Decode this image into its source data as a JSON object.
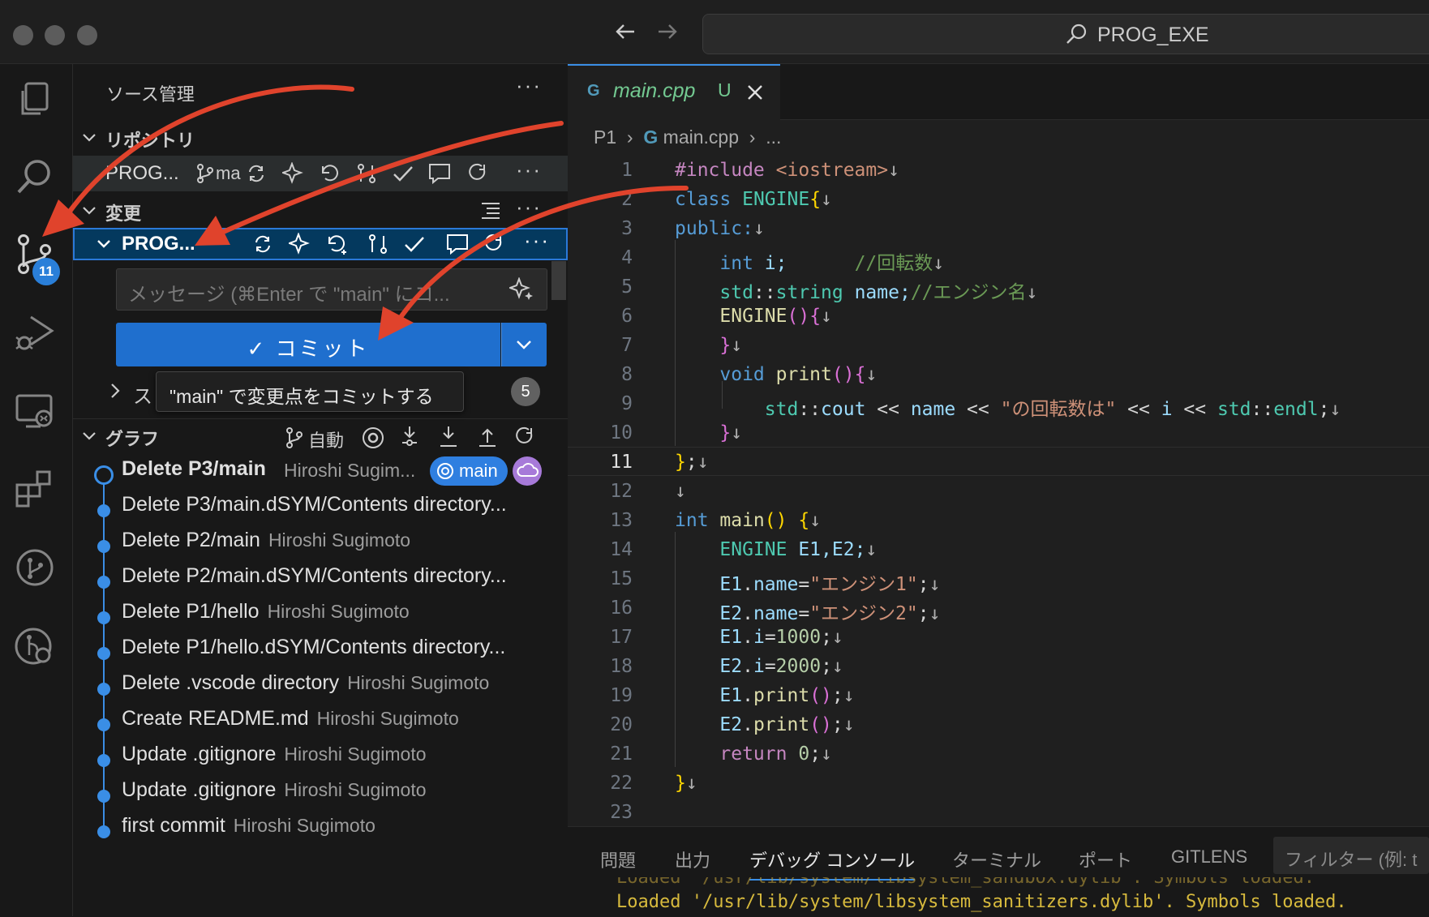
{
  "window": {
    "search_text": "PROG_EXE"
  },
  "activity_bar": {
    "items": [
      "explorer-icon",
      "search-icon",
      "source-control-icon",
      "run-debug-icon",
      "remote-explorer-icon",
      "extensions-icon",
      "git-graph-icon",
      "gitlens-icon"
    ],
    "source_control_badge": "11"
  },
  "sidebar": {
    "title": "ソース管理",
    "repos_section": "リポジトリ",
    "repo_name": "PROG...",
    "repo_branch": "ma",
    "changes_section": "変更",
    "changes_repo": "PROG...",
    "message_placeholder": "メッセージ (⌘Enter で \"main\" にコ...",
    "commit_label": "✓ コミット",
    "staged_label": "ス",
    "staged_count": "5",
    "tooltip": "\"main\" で変更点をコミットする",
    "graph_section": "グラフ",
    "graph_auto": "自動",
    "graph": [
      {
        "title": "Delete P3/main",
        "author": "Hiroshi Sugim..."
      },
      {
        "title": "Delete P3/main.dSYM/Contents directory...",
        "author": ""
      },
      {
        "title": "Delete P2/main",
        "author": "Hiroshi Sugimoto"
      },
      {
        "title": "Delete P2/main.dSYM/Contents directory...",
        "author": ""
      },
      {
        "title": "Delete P1/hello",
        "author": "Hiroshi Sugimoto"
      },
      {
        "title": "Delete P1/hello.dSYM/Contents directory...",
        "author": ""
      },
      {
        "title": "Delete .vscode directory",
        "author": "Hiroshi Sugimoto"
      },
      {
        "title": "Create README.md",
        "author": "Hiroshi Sugimoto"
      },
      {
        "title": "Update .gitignore",
        "author": "Hiroshi Sugimoto"
      },
      {
        "title": "Update .gitignore",
        "author": "Hiroshi Sugimoto"
      },
      {
        "title": "first commit",
        "author": "Hiroshi Sugimoto"
      }
    ],
    "head_branch": "main"
  },
  "editor": {
    "tab_name": "main.cpp",
    "tab_status": "U",
    "breadcrumb": [
      "P1",
      "main.cpp",
      "..."
    ],
    "active_line": 11,
    "line_numbers": [
      "1",
      "2",
      "3",
      "4",
      "5",
      "6",
      "7",
      "8",
      "9",
      "10",
      "11",
      "12",
      "13",
      "14",
      "15",
      "16",
      "17",
      "18",
      "19",
      "20",
      "21",
      "22",
      "23"
    ],
    "code_tokens": {
      "l1": [
        "#include",
        " <iostream>",
        "↓"
      ],
      "l2": [
        "class",
        " ENGINE",
        "{",
        "↓"
      ],
      "l3": [
        "public:",
        "↓"
      ],
      "l4": [
        "    int",
        " i;",
        "      //回転数",
        "↓"
      ],
      "l5": [
        "    std",
        "::",
        "string",
        " name;",
        "//エンジン名",
        "↓"
      ],
      "l6": [
        "    ENGINE",
        "()",
        "{",
        "↓"
      ],
      "l7": [
        "    }",
        "↓"
      ],
      "l8": [
        "    void",
        " print",
        "()",
        "{",
        "↓"
      ],
      "l9": [
        "        std",
        "::",
        "cout",
        " << ",
        "name",
        " << ",
        "\"の回転数は\"",
        " << ",
        "i",
        " << ",
        "std",
        "::",
        "endl",
        ";",
        "↓"
      ],
      "l10": [
        "    }",
        "↓"
      ],
      "l11": [
        "}",
        ";",
        "↓"
      ],
      "l12": [
        "↓"
      ],
      "l13": [
        "int",
        " main",
        "()",
        " {",
        "↓"
      ],
      "l14": [
        "    ENGINE",
        " E1,E2;",
        "↓"
      ],
      "l15": [
        "    E1",
        ".",
        "name",
        "=",
        "\"エンジン1\"",
        ";",
        "↓"
      ],
      "l16": [
        "    E2",
        ".",
        "name",
        "=",
        "\"エンジン2\"",
        ";",
        "↓"
      ],
      "l17": [
        "    E1",
        ".",
        "i",
        "=",
        "1000",
        ";",
        "↓"
      ],
      "l18": [
        "    E2",
        ".",
        "i",
        "=",
        "2000",
        ";",
        "↓"
      ],
      "l19": [
        "    E1",
        ".",
        "print",
        "()",
        ";",
        "↓"
      ],
      "l20": [
        "    E2",
        ".",
        "print",
        "()",
        ";",
        "↓"
      ],
      "l21": [
        "    return",
        " 0",
        ";",
        "↓"
      ],
      "l22": [
        "}",
        "↓"
      ]
    }
  },
  "panel": {
    "tabs": [
      "問題",
      "出力",
      "デバッグ コンソール",
      "ターミナル",
      "ポート",
      "GITLENS"
    ],
    "active_tab": "デバッグ コンソール",
    "filter_placeholder": "フィルター (例: t",
    "console_lines": [
      "Loaded '/usr/lib/system/libsystem_sandbox.dylib'. Symbols loaded.",
      "Loaded '/usr/lib/system/libsystem_sanitizers.dylib'. Symbols loaded."
    ]
  },
  "colors": {
    "accent": "#3a8ee6",
    "commit_button": "#1f6fce",
    "annotation_arrow": "#e0432c",
    "modified": "#73c991"
  }
}
